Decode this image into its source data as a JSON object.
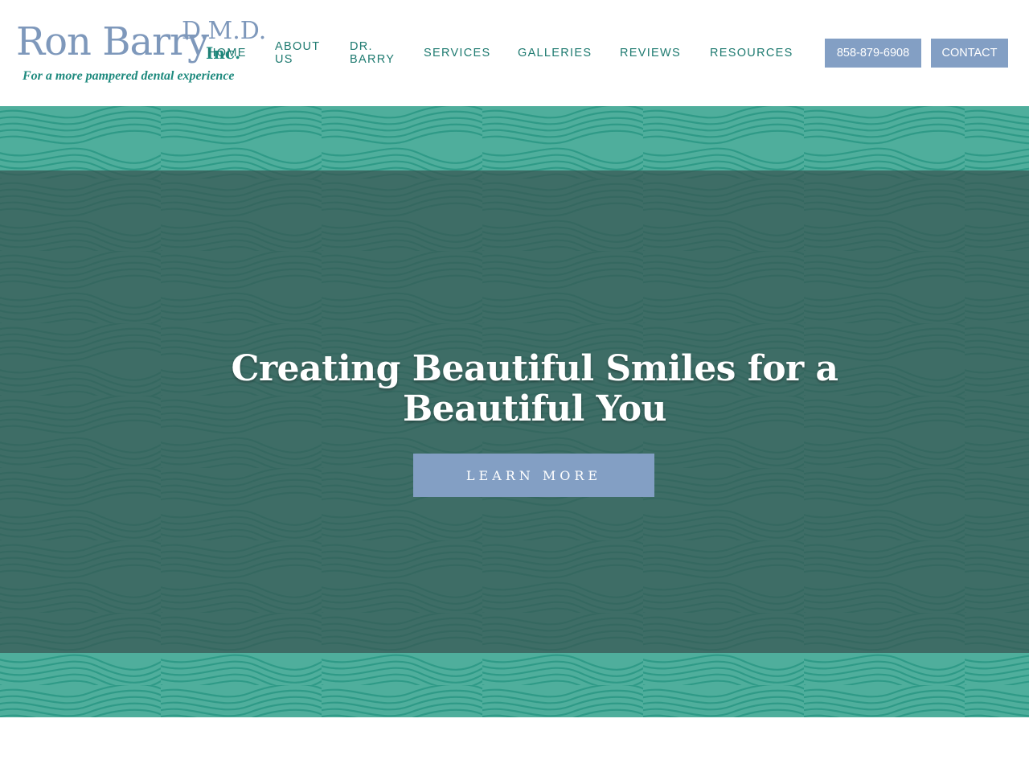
{
  "logo": {
    "name": "Ron Barry",
    "credential": "D.M.D.",
    "suffix": "Inc.",
    "tagline": "For a more pampered dental experience"
  },
  "nav": {
    "home": "HOME",
    "about": "ABOUT US",
    "dr_barry": "DR. BARRY",
    "services": "SERVICES",
    "galleries": "GALLERIES",
    "reviews": "REVIEWS",
    "resources": "RESOURCES"
  },
  "header_buttons": {
    "phone": "858-879-6908",
    "contact": "CONTACT"
  },
  "hero": {
    "heading": "Creating Beautiful Smiles for a Beautiful You",
    "button": "LEARN MORE"
  },
  "colors": {
    "accent_blue": "#839fc4",
    "brand_teal": "#1e8a7e",
    "hero_teal": "#4fae9c",
    "overlay_dark": "#385452"
  }
}
